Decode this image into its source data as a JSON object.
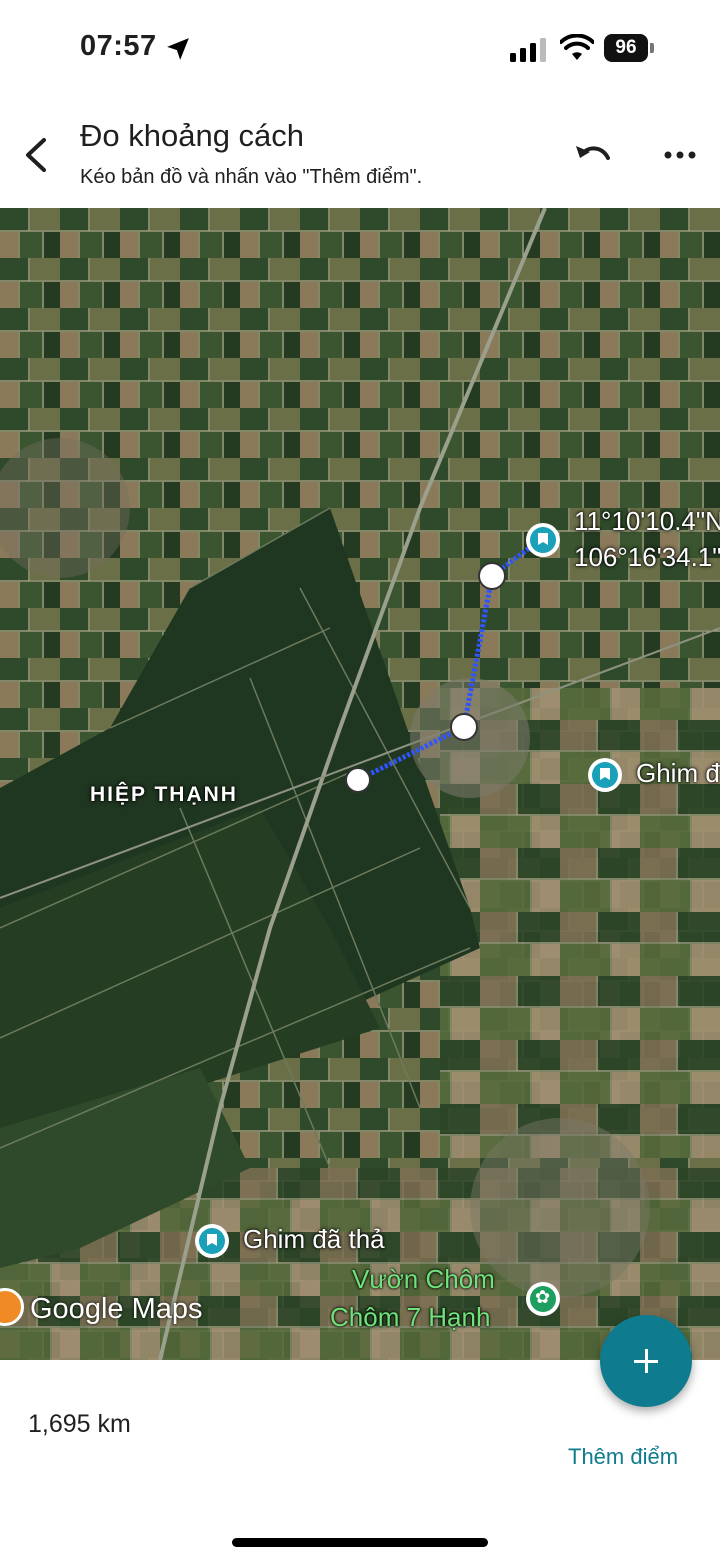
{
  "status_bar": {
    "time": "07:57",
    "battery": "96"
  },
  "header": {
    "title": "Đo khoảng cách",
    "subtitle": "Kéo bản đồ và nhấn vào \"Thêm điểm\"."
  },
  "map": {
    "coord_line1": "11°10'10.4\"N",
    "coord_line2": "106°16'34.1\"",
    "pin_right": "Ghim đ",
    "place_name": "HIỆP THẠNH",
    "pin_dropped": "Ghim đã thả",
    "garden_line1": "Vườn Chôm",
    "garden_line2": "Chôm 7 Hạnh",
    "logo": "Google Maps"
  },
  "bottom": {
    "distance": "1,695 km",
    "add_point": "Thêm điểm"
  },
  "colors": {
    "accent": "#0e7c8e",
    "route": "#2f55ff",
    "pin": "#1aa0b8"
  },
  "icons": [
    "location-arrow-icon",
    "signal-icon",
    "wifi-icon",
    "battery-icon",
    "back-arrow-icon",
    "undo-icon",
    "more-icon",
    "pin-icon",
    "plus-icon"
  ]
}
